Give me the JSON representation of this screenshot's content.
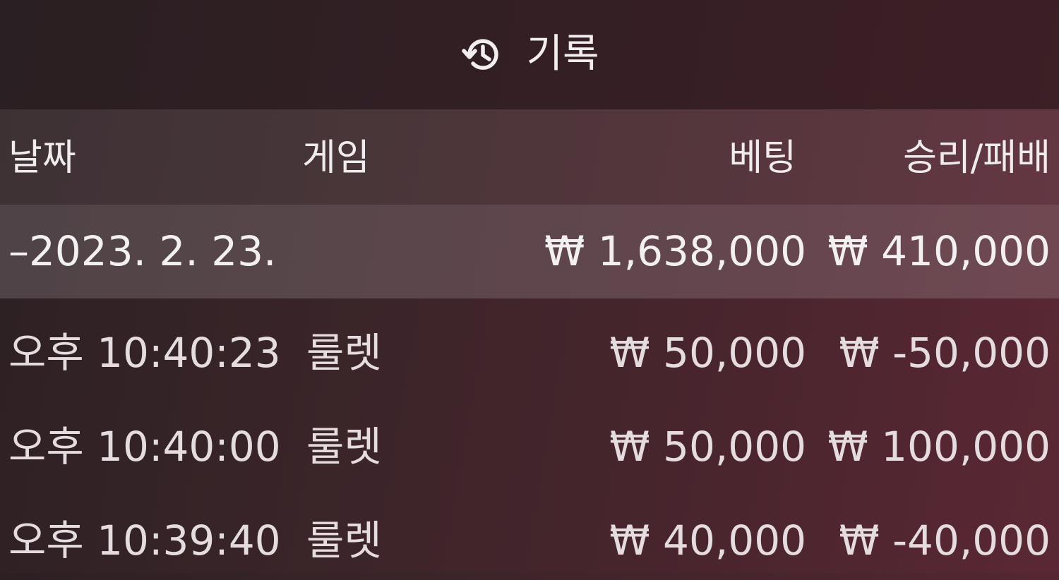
{
  "header": {
    "title": "기록",
    "icon": "history-icon"
  },
  "columns": {
    "date": "날짜",
    "game": "게임",
    "bet": "베팅",
    "result": "승리/패배"
  },
  "summary": {
    "date": "–2023. 2. 23.",
    "bet": "₩ 1,638,000",
    "result": "₩ 410,000"
  },
  "rows": [
    {
      "time": "오후 10:40:23",
      "game": "룰렛",
      "bet": "₩ 50,000",
      "result": "₩ -50,000"
    },
    {
      "time": "오후 10:40:00",
      "game": "룰렛",
      "bet": "₩ 50,000",
      "result": "₩ 100,000"
    },
    {
      "time": "오후 10:39:40",
      "game": "룰렛",
      "bet": "₩ 40,000",
      "result": "₩ -40,000"
    }
  ],
  "colors": {
    "background": "#3a2529",
    "text": "#eae4e6",
    "summary_highlight": "#5a4b50"
  }
}
